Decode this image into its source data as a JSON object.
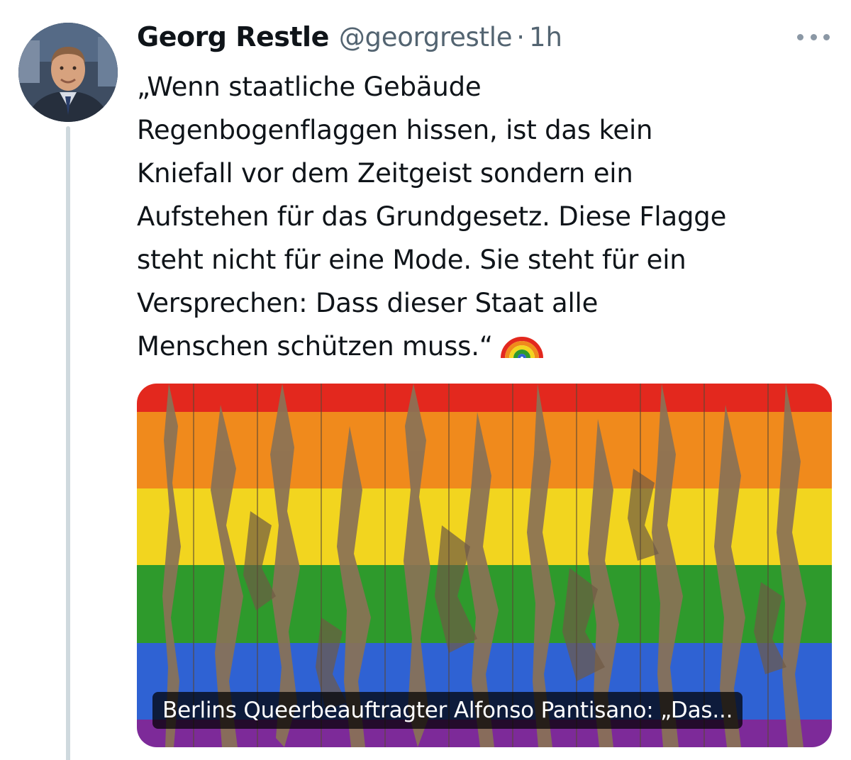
{
  "author": {
    "name": "Georg Restle",
    "handle": "@georgrestle",
    "separator": "·",
    "time": "1h"
  },
  "tweet": {
    "lines": [
      "„Wenn staatliche Gebäude",
      "Regenbogenflaggen hissen, ist das kein",
      "Kniefall vor dem Zeitgeist sondern ein",
      "Aufstehen für das Grundgesetz. Diese Flagge",
      "steht nicht für eine Mode. Sie steht für ein",
      "Versprechen: Dass dieser Staat alle",
      "Menschen schützen muss.“"
    ],
    "emoji": "rainbow-icon"
  },
  "link_card": {
    "title": "Berlins Queerbeauftragter Alfonso Pantisano: „Das...",
    "image": "weathered-rainbow-flag-on-wooden-planks",
    "stripe_colors": [
      "#e3281e",
      "#f08a1c",
      "#f2d51f",
      "#2e9a2c",
      "#2f62d3",
      "#7d2a99"
    ]
  },
  "icons": {
    "more": "more-options-icon",
    "avatar": "author-avatar"
  }
}
